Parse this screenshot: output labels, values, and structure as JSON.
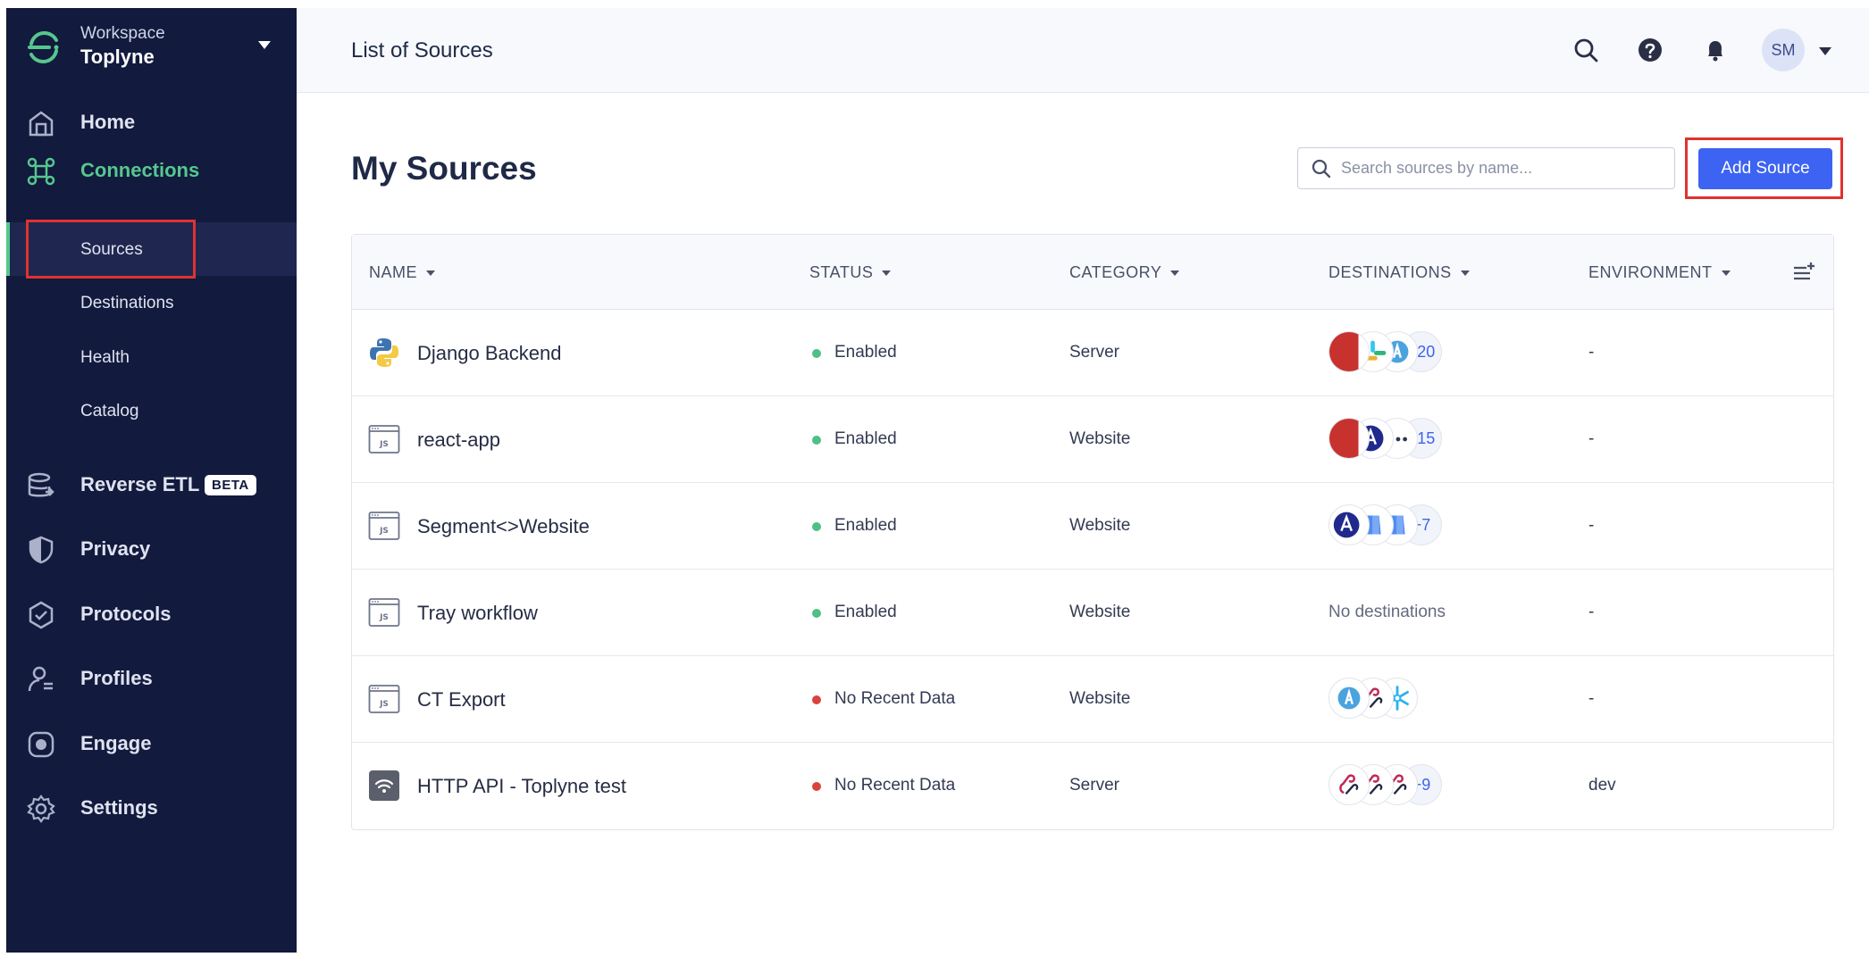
{
  "colors": {
    "sidebar_bg": "#121a3e",
    "accent_green": "#56c78e",
    "primary_blue": "#3d63f2",
    "status_enabled": "#4fbf86",
    "status_no_data": "#d8433f",
    "highlight_red": "#e0322f"
  },
  "workspace": {
    "kicker": "Workspace",
    "name": "Toplyne",
    "logo_icon": "segment-logo-icon"
  },
  "nav": {
    "home": {
      "label": "Home",
      "icon": "home-icon"
    },
    "connections": {
      "label": "Connections",
      "icon": "connections-icon"
    },
    "sources": {
      "label": "Sources"
    },
    "destinations": {
      "label": "Destinations"
    },
    "health": {
      "label": "Health"
    },
    "catalog": {
      "label": "Catalog"
    },
    "reverse_etl": {
      "label": "Reverse ETL",
      "badge": "BETA",
      "icon": "database-icon"
    },
    "privacy": {
      "label": "Privacy",
      "icon": "shield-icon"
    },
    "protocols": {
      "label": "Protocols",
      "icon": "protocols-icon"
    },
    "profiles": {
      "label": "Profiles",
      "icon": "profiles-icon"
    },
    "engage": {
      "label": "Engage",
      "icon": "engage-icon"
    },
    "settings": {
      "label": "Settings",
      "icon": "gear-icon"
    }
  },
  "header": {
    "title": "List of Sources",
    "avatar_initials": "SM",
    "icons": [
      "search-icon",
      "help-icon",
      "bell-icon"
    ]
  },
  "main": {
    "title": "My Sources",
    "search_placeholder": "Search sources by name...",
    "add_button": "Add Source"
  },
  "table": {
    "columns": [
      "NAME",
      "STATUS",
      "CATEGORY",
      "DESTINATIONS",
      "ENVIRONMENT"
    ],
    "rows": [
      {
        "name": "Django Backend",
        "icon": "python-icon",
        "status": "Enabled",
        "status_kind": "ok",
        "category": "Server",
        "destinations": [
          "redshift-icon",
          "slack-icon",
          "webhook-icon"
        ],
        "more": "+20",
        "environment": "-"
      },
      {
        "name": "react-app",
        "icon": "javascript-icon",
        "status": "Enabled",
        "status_kind": "ok",
        "category": "Website",
        "destinations": [
          "redshift-icon",
          "amplitude-icon",
          "dots-icon"
        ],
        "more": "+15",
        "environment": "-"
      },
      {
        "name": "Segment<>Website",
        "icon": "javascript-icon",
        "status": "Enabled",
        "status_kind": "ok",
        "category": "Website",
        "destinations": [
          "amplitude-icon",
          "bigquery-icon",
          "bigquery-icon"
        ],
        "more": "+7",
        "environment": "-"
      },
      {
        "name": "Tray workflow",
        "icon": "javascript-icon",
        "status": "Enabled",
        "status_kind": "ok",
        "category": "Website",
        "destinations": [],
        "no_destinations": "No destinations",
        "more": "",
        "environment": "-"
      },
      {
        "name": "CT Export",
        "icon": "javascript-icon",
        "status": "No Recent Data",
        "status_kind": "warn",
        "category": "Website",
        "destinations": [
          "webhook-icon",
          "hook-icon",
          "snowflake-icon"
        ],
        "more": "",
        "environment": "-"
      },
      {
        "name": "HTTP API - Toplyne test",
        "icon": "http-api-icon",
        "status": "No Recent Data",
        "status_kind": "warn",
        "category": "Server",
        "destinations": [
          "hook-icon",
          "hook-icon",
          "hook-icon"
        ],
        "more": "+9",
        "environment": "dev"
      }
    ]
  }
}
